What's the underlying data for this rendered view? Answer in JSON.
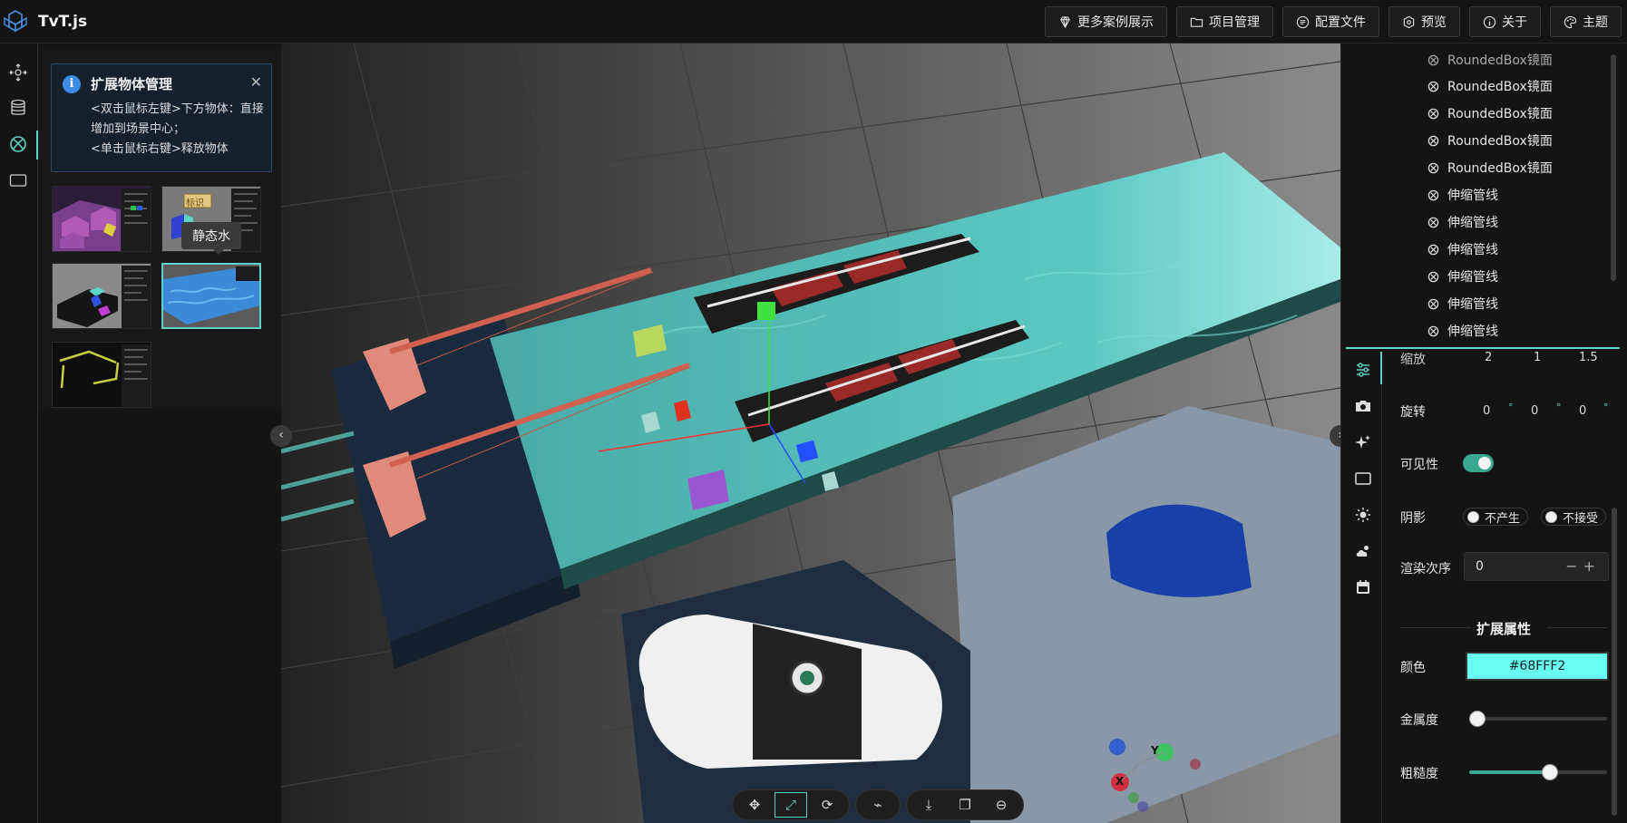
{
  "app": {
    "title": "TvT.js"
  },
  "header": {
    "buttons": [
      {
        "label": "更多案例展示",
        "icon": "diamond-icon"
      },
      {
        "label": "项目管理",
        "icon": "folder-icon"
      },
      {
        "label": "配置文件",
        "icon": "config-icon"
      },
      {
        "label": "预览",
        "icon": "preview-icon"
      },
      {
        "label": "关于",
        "icon": "info-icon"
      },
      {
        "label": "主题",
        "icon": "palette-icon"
      }
    ]
  },
  "notice": {
    "title": "扩展物体管理",
    "line1": "<双击鼠标左键>下方物体：直接增加到场景中心；",
    "line2": "<单击鼠标右键>释放物体"
  },
  "thumbs": {
    "label_badge": "标识",
    "tooltip": "静态水"
  },
  "tree": {
    "items": [
      "RoundedBox镜面",
      "RoundedBox镜面",
      "RoundedBox镜面",
      "RoundedBox镜面",
      "RoundedBox镜面",
      "伸缩管线",
      "伸缩管线",
      "伸缩管线",
      "伸缩管线",
      "伸缩管线",
      "伸缩管线"
    ]
  },
  "props": {
    "scale_label": "缩放",
    "scale": [
      "2",
      "1",
      "1.5"
    ],
    "rotation_label": "旋转",
    "rotation": [
      "0",
      "0",
      "0"
    ],
    "degree": "°",
    "visible_label": "可见性",
    "shadow_label": "阴影",
    "shadow_cast": "不产生",
    "shadow_receive": "不接受",
    "render_order_label": "渲染次序",
    "render_order": "0",
    "render_ctl": "−+",
    "ext_title": "扩展属性",
    "color_label": "颜色",
    "color_value": "#68FFF2",
    "metalness_label": "金属度",
    "metalness": 0,
    "roughness_label": "粗糙度",
    "roughness": 0.6
  },
  "gizmo": {
    "y": "Y",
    "x": "X"
  },
  "colors": {
    "accent": "#5fd4c4",
    "water": "#4fb8b4",
    "color_swatch": "#68fff2"
  }
}
